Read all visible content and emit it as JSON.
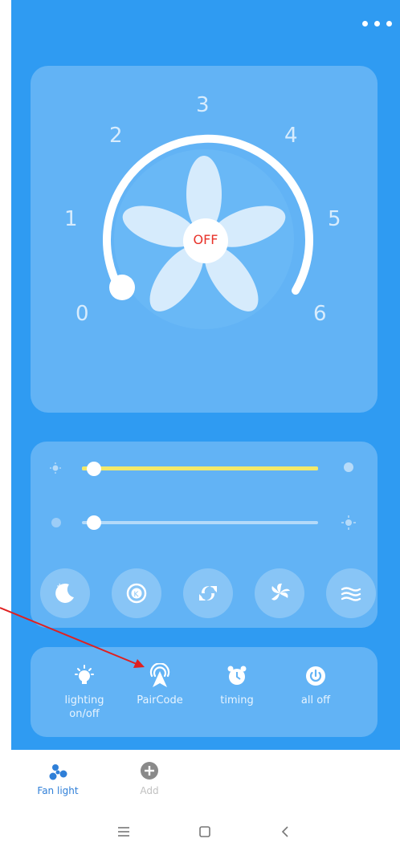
{
  "colors": {
    "background": "#2f9bf2",
    "card": "#62b3f5",
    "accent_yellow": "#f2e96a",
    "off_red": "#e8332a",
    "nav_active": "#2f7fd8"
  },
  "dial": {
    "status": "OFF",
    "current_speed": 0,
    "speed_labels": [
      "0",
      "1",
      "2",
      "3",
      "4",
      "5",
      "6"
    ]
  },
  "sliders": {
    "brightness": {
      "value_percent": 0,
      "icon_left": "sun-small-icon",
      "icon_right": "sun-large-icon"
    },
    "color_temp": {
      "value_percent": 0,
      "icon_left": "dot-icon",
      "icon_right": "sun-icon"
    }
  },
  "modes": [
    {
      "icon": "sleep-moon-icon"
    },
    {
      "icon": "k-mode-icon"
    },
    {
      "icon": "reverse-rotation-icon"
    },
    {
      "icon": "fan-swirl-icon"
    },
    {
      "icon": "natural-wind-icon"
    }
  ],
  "actions": [
    {
      "label": "lighting\non/off",
      "icon": "light-bulb-icon"
    },
    {
      "label": "PairCode",
      "icon": "pair-signal-icon"
    },
    {
      "label": "timing",
      "icon": "alarm-clock-icon"
    },
    {
      "label": "all off",
      "icon": "power-icon"
    }
  ],
  "bottom_nav": {
    "items": [
      {
        "label": "Fan light",
        "icon": "fan-icon",
        "active": true
      },
      {
        "label": "Add",
        "icon": "plus-circle-icon",
        "active": false
      }
    ]
  }
}
